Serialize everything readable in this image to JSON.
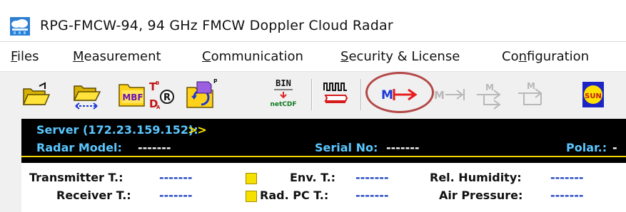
{
  "window": {
    "title": "RPG-FMCW-94, 94 GHz FMCW Doppler Cloud Radar"
  },
  "menu": {
    "items": [
      {
        "mnemonic": "F",
        "rest": "iles"
      },
      {
        "mnemonic": "M",
        "rest": "easurement"
      },
      {
        "mnemonic": "C",
        "rest": "ommunication"
      },
      {
        "mnemonic": "S",
        "rest": "ecurity & License"
      },
      {
        "pre": "Co",
        "mnemonic": "n",
        "rest": "figuration"
      }
    ]
  },
  "toolbar": {
    "tb_badge_mbf": "MBF",
    "tb_bin_text": "BIN",
    "tb_netcdf_text": "netCDF",
    "tb_m_text": "M",
    "tb_sun_text": "SUN",
    "tb_tb_text": "T",
    "tb_sub_b": "B",
    "tb_da_text": "D",
    "tb_sub_a": "A",
    "tb_r_text": "R",
    "tb_p_text": "P",
    "highlight_color": "#b44848"
  },
  "status": {
    "server_label": "Server (172.23.159.152):",
    "server_arrows": ">>",
    "radar_model_label": "Radar Model:",
    "radar_model_value": "-------",
    "serial_label": "Serial No:",
    "serial_value": "-------",
    "polar_label": "Polar.:",
    "polar_value": "-"
  },
  "sensors": {
    "transmitter_label": "Transmitter T.:",
    "transmitter_value": "-------",
    "receiver_label": "Receiver T.:",
    "receiver_value": "-------",
    "env_label": "Env. T.:",
    "env_value": "-------",
    "radpc_label": "Rad. PC T.:",
    "radpc_value": "-------",
    "humidity_label": "Rel. Humidity:",
    "humidity_value": "-------",
    "pressure_label": "Air Pressure:",
    "pressure_value": "-------"
  }
}
